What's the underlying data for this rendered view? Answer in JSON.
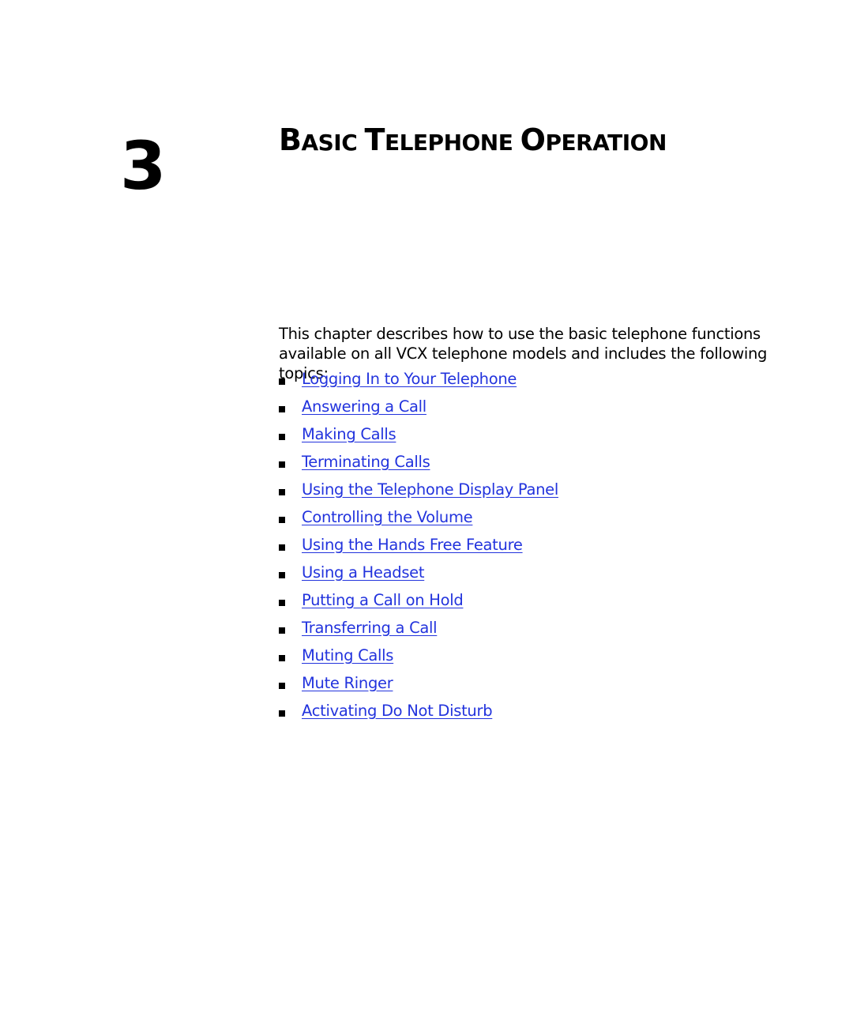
{
  "chapter": {
    "number": "3",
    "title_parts": [
      {
        "cap": "B",
        "rest": "ASIC "
      },
      {
        "cap": "T",
        "rest": "ELEPHONE "
      },
      {
        "cap": "O",
        "rest": "PERATION"
      }
    ]
  },
  "intro": "This chapter describes how to use the basic telephone functions available on all VCX telephone models and includes the following topics:",
  "topics": [
    "Logging In to Your Telephone",
    "Answering a Call",
    "Making Calls",
    "Terminating Calls",
    "Using the Telephone Display Panel",
    "Controlling the Volume",
    "Using the Hands Free Feature",
    "Using a Headset",
    "Putting a Call on Hold",
    "Transferring a Call",
    "Muting Calls",
    "Mute Ringer",
    "Activating Do Not Disturb"
  ],
  "colors": {
    "link": "#2233dd",
    "text": "#000000"
  }
}
